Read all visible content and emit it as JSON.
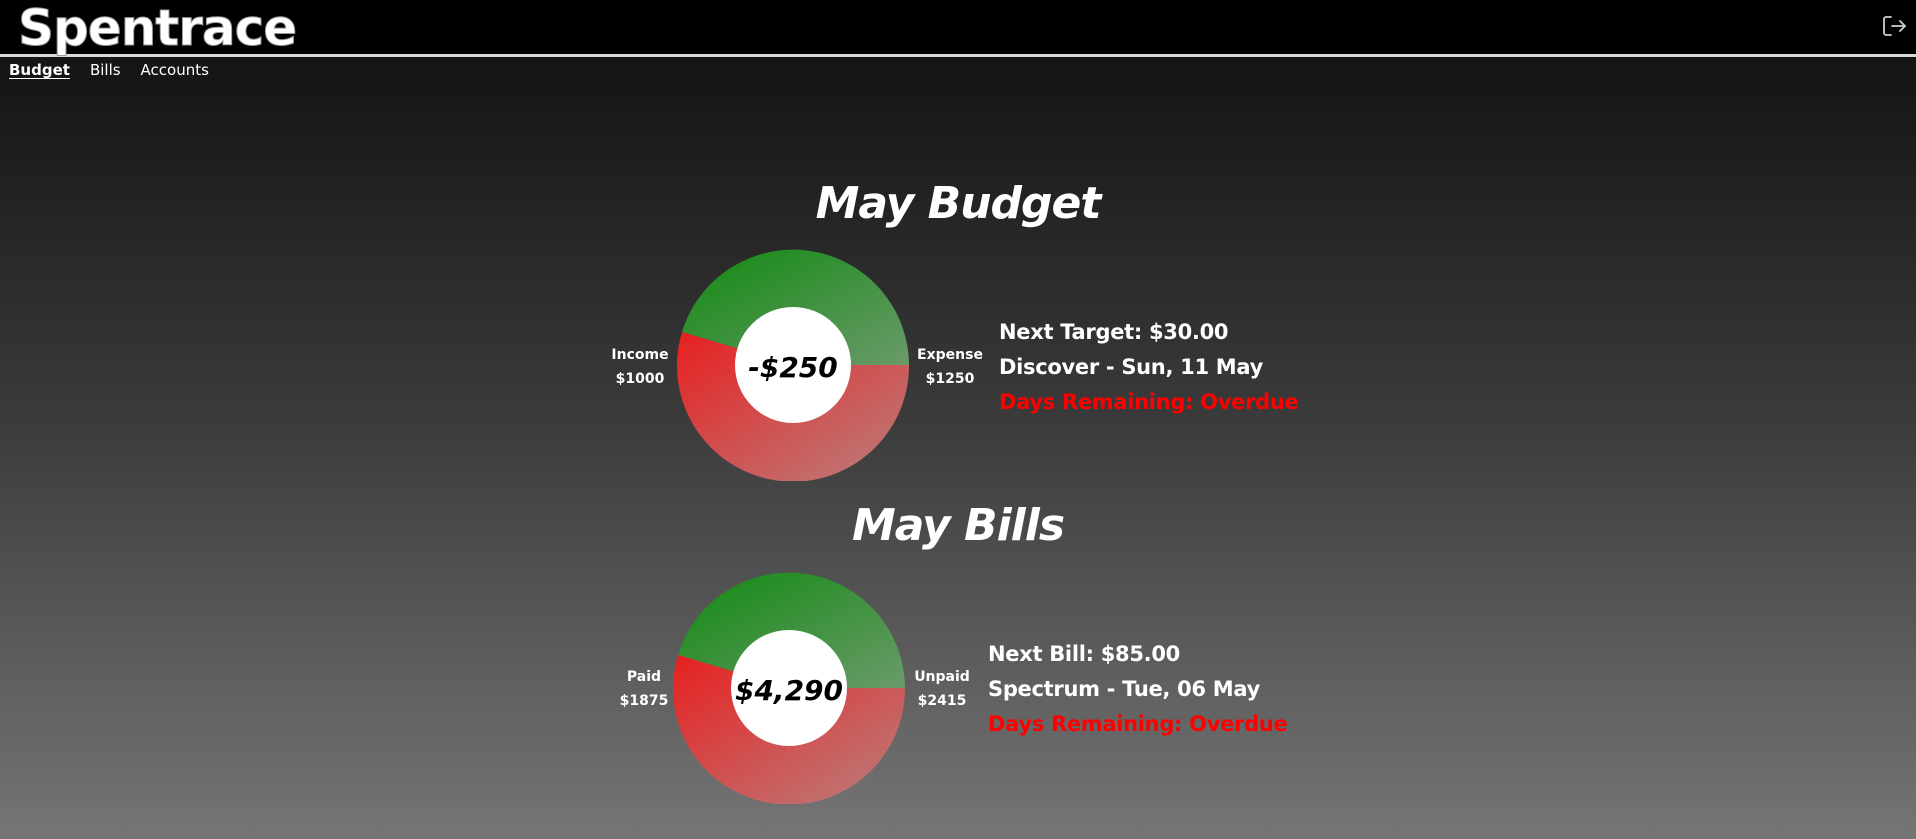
{
  "header": {
    "logo": "Spentrace",
    "logout_icon": "logout-icon"
  },
  "nav": {
    "items": [
      {
        "label": "Budget",
        "active": true
      },
      {
        "label": "Bills",
        "active": false
      },
      {
        "label": "Accounts",
        "active": false
      }
    ]
  },
  "budget": {
    "title": "May Budget",
    "center_value": "-$250",
    "left_label": "Income",
    "left_value": "$1000",
    "right_label": "Expense",
    "right_value": "$1250",
    "next_line": "Next Target: $30.00",
    "date_line": "Discover - Sun, 11 May",
    "days_line": "Days Remaining: Overdue"
  },
  "bills": {
    "title": "May Bills",
    "center_value": "$4,290",
    "left_label": "Paid",
    "left_value": "$1875",
    "right_label": "Unpaid",
    "right_value": "$2415",
    "next_line": "Next Bill: $85.00",
    "date_line": "Spectrum - Tue, 06 May",
    "days_line": "Days Remaining: Overdue"
  },
  "colors": {
    "green": "#1f8a1f",
    "red": "#e52a2a",
    "overdue": "#ff0000",
    "background": "#1a1a1a"
  }
}
